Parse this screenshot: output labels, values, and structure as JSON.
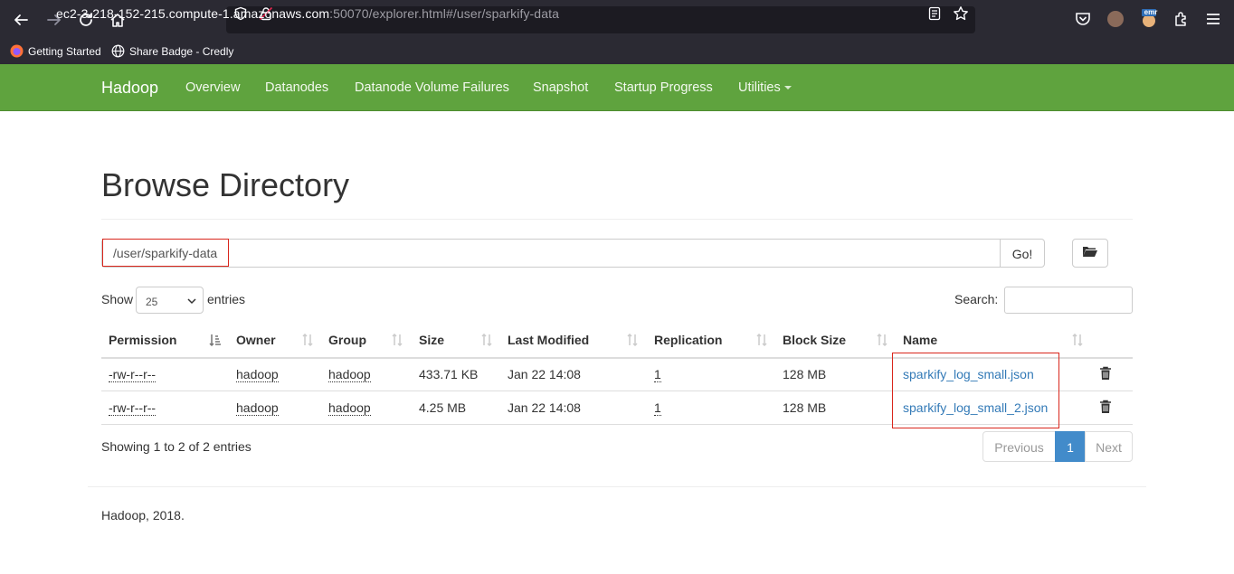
{
  "browser": {
    "url_host": "ec2-3-218-152-215.compute-1.amazonaws.com",
    "url_rest": ":50070/explorer.html#/user/sparkify-data",
    "extension_badge": "emr",
    "bookmarks": [
      "Getting Started",
      "Share Badge - Credly"
    ]
  },
  "navbar": {
    "brand": "Hadoop",
    "links": [
      "Overview",
      "Datanodes",
      "Datanode Volume Failures",
      "Snapshot",
      "Startup Progress",
      "Utilities"
    ],
    "color": "#5fa33e"
  },
  "page": {
    "title": "Browse Directory",
    "path": "/user/sparkify-data",
    "go_label": "Go!",
    "show_label": "Show",
    "entries_value": "25",
    "entries_label": "entries",
    "search_label": "Search:"
  },
  "table": {
    "headers": [
      "Permission",
      "Owner",
      "Group",
      "Size",
      "Last Modified",
      "Replication",
      "Block Size",
      "Name"
    ],
    "rows": [
      [
        "-rw-r--r--",
        "hadoop",
        "hadoop",
        "433.71 KB",
        "Jan 22 14:08",
        "1",
        "128 MB",
        "sparkify_log_small.json"
      ],
      [
        "-rw-r--r--",
        "hadoop",
        "hadoop",
        "4.25 MB",
        "Jan 22 14:08",
        "1",
        "128 MB",
        "sparkify_log_small_2.json"
      ]
    ]
  },
  "pagination": {
    "info": "Showing 1 to 2 of 2 entries",
    "previous": "Previous",
    "current": "1",
    "next": "Next"
  },
  "footer": "Hadoop, 2018.",
  "colors": {
    "link": "#337ab7",
    "highlight": "#d9261c",
    "pager_active": "#428bca"
  }
}
